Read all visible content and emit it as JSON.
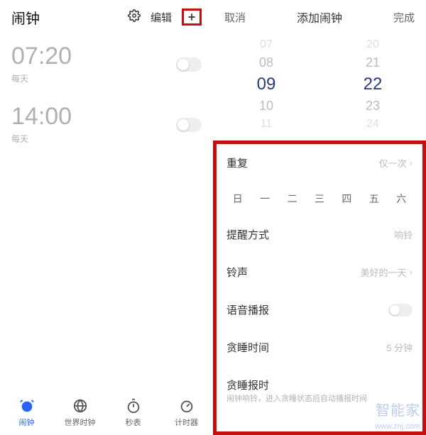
{
  "left": {
    "title": "闹钟",
    "edit": "编辑",
    "alarms": [
      {
        "time": "07:20",
        "sub": "每天"
      },
      {
        "time": "14:00",
        "sub": "每天"
      }
    ],
    "nav": [
      {
        "id": "alarm",
        "label": "闹钟"
      },
      {
        "id": "world",
        "label": "世界时钟"
      },
      {
        "id": "stopwatch",
        "label": "秒表"
      },
      {
        "id": "timer",
        "label": "计时器"
      }
    ]
  },
  "right": {
    "cancel": "取消",
    "title": "添加闹钟",
    "done": "完成",
    "picker_hours": [
      "07",
      "08",
      "09",
      "10",
      "11"
    ],
    "picker_minutes": [
      "20",
      "21",
      "22",
      "23",
      "24"
    ],
    "repeat_label": "重复",
    "repeat_value": "仅一次",
    "weekdays": [
      "日",
      "一",
      "二",
      "三",
      "四",
      "五",
      "六"
    ],
    "remind_label": "提醒方式",
    "remind_value": "响铃",
    "ring_label": "铃声",
    "ring_value": "美好的一天",
    "voice_label": "语音播报",
    "snooze_time_label": "贪睡时间",
    "snooze_time_value": "5 分钟",
    "snooze_report_label": "贪睡报时",
    "snooze_report_sub": "闹钟响铃，进入贪睡状态后自动播报时间"
  },
  "watermark": {
    "main": "智能家",
    "sub": "www.znj.com"
  }
}
